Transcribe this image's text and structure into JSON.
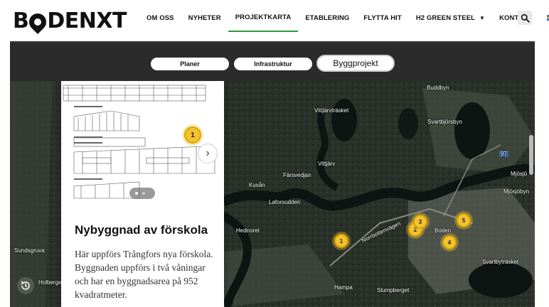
{
  "logo": {
    "text_before": "B",
    "text_after": "DENXT"
  },
  "nav": {
    "items": [
      {
        "label": "OM OSS"
      },
      {
        "label": "NYHETER"
      },
      {
        "label": "PROJEKTKARTA",
        "active": true
      },
      {
        "label": "ETABLERING"
      },
      {
        "label": "FLYTTA HIT"
      },
      {
        "label": "H2 GREEN STEEL",
        "has_caret": true
      }
    ],
    "last": "KONTAKT",
    "language_flag": "sweden-flag-icon",
    "search_icon": "search-icon",
    "active_color": "#2e9a3a"
  },
  "tabs": [
    {
      "label": "Planer"
    },
    {
      "label": "Infrastruktur"
    },
    {
      "label": "Byggprojekt",
      "active": true
    }
  ],
  "map": {
    "labels": {
      "buddbyn": "Buddbyn",
      "vittjarvtrasket": "Vittjärvträsket",
      "svartbjorsbyn": "Svartbjörsbyn",
      "farsvedjan": "Färsvedjan",
      "vittjarv": "Vittjärv",
      "kusan": "Kusån",
      "laforsudden": "Laforsudden",
      "hednoret": "Hednoret",
      "boden": "Boden",
      "mjosjo": "Mjösjö",
      "mjosjobyn": "Mjösjöbyn",
      "svartbytrasket": "Svartbyträsket",
      "slumpberget": "Slumpberget",
      "hampa": "Hampa",
      "holberget": "Holberget",
      "norrbottenvagen": "Norrbottenvägen",
      "sundsgruva": "Sundsgruva",
      "road_97": "97"
    },
    "markers": [
      "1",
      "2",
      "3",
      "4",
      "5"
    ]
  },
  "card": {
    "marker": "1",
    "title": "Nybyggnad av förskola",
    "text": "Här uppförs Trångfors nya förskola. Byggnaden uppförs i två våningar och har en byggnadsarea på 952 kvadratmeter.",
    "next_icon": "chevron-right-icon",
    "slides": 2,
    "active_slide": 1
  },
  "history_icon": "history-icon"
}
